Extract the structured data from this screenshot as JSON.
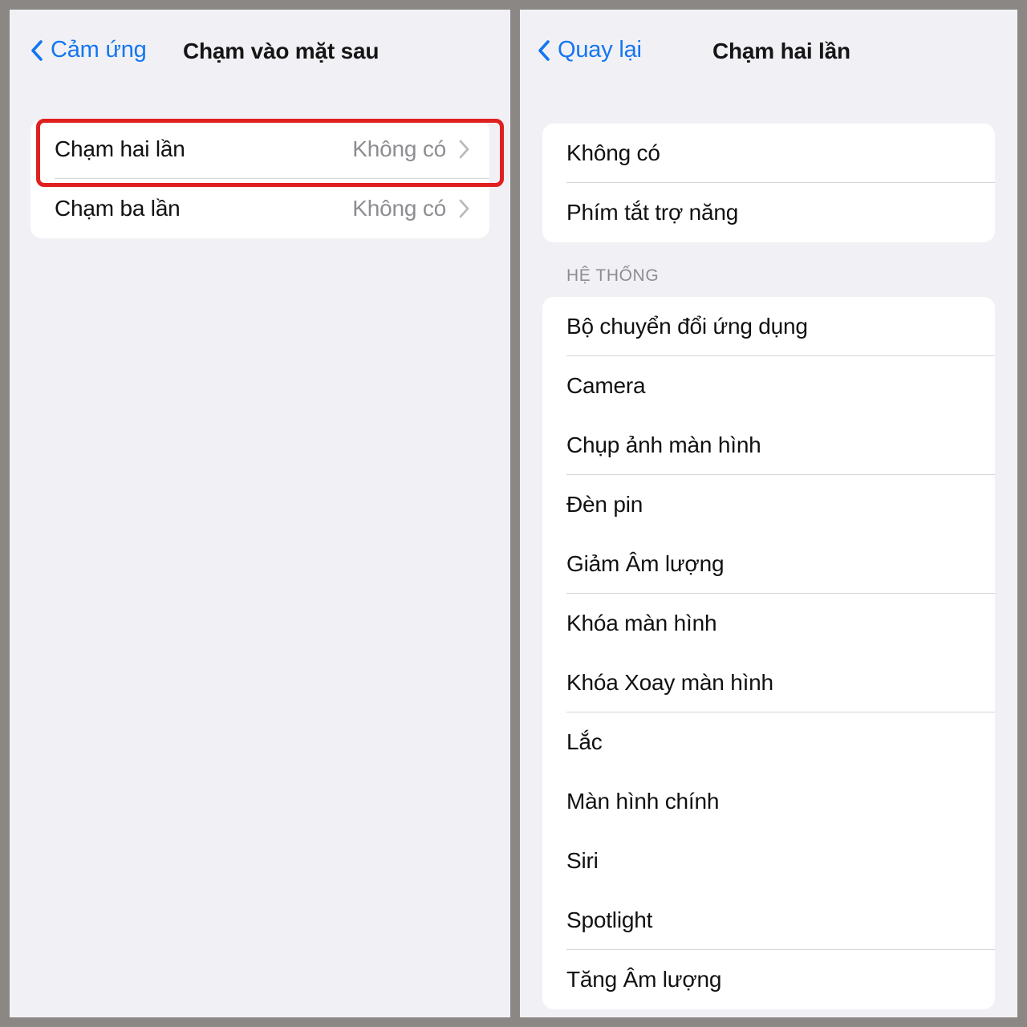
{
  "colors": {
    "frame_border": "#8b8785",
    "panel_background": "#f1f1f5",
    "card_background": "#ffffff",
    "accent_blue": "#1476f0",
    "secondary_text": "#8d8d92",
    "primary_text": "#111111",
    "separator": "#d6d6da",
    "annotation_red": "#e02020"
  },
  "left_panel": {
    "navbar": {
      "back_label": "Cảm ứng",
      "back_icon": "chevron-left-icon",
      "title": "Chạm vào mặt sau"
    },
    "rows": [
      {
        "label": "Chạm hai lần",
        "value": "Không có",
        "accessory": "chevron-right-icon",
        "highlighted": true
      },
      {
        "label": "Chạm ba lần",
        "value": "Không có",
        "accessory": "chevron-right-icon",
        "highlighted": false
      }
    ]
  },
  "right_panel": {
    "navbar": {
      "back_label": "Quay lại",
      "back_icon": "chevron-left-icon",
      "title": "Chạm hai lần"
    },
    "top_group": [
      {
        "label": "Không có"
      },
      {
        "label": "Phím tắt trợ năng"
      }
    ],
    "system_section": {
      "header": "HỆ THỐNG",
      "rows": [
        {
          "label": "Bộ chuyển đổi ứng dụng",
          "highlighted": false
        },
        {
          "label": "Camera",
          "highlighted": false
        },
        {
          "label": "Chụp ảnh màn hình",
          "highlighted": false
        },
        {
          "label": "Đèn pin",
          "highlighted": false
        },
        {
          "label": "Giảm Âm lượng",
          "highlighted": false
        },
        {
          "label": "Khóa màn hình",
          "highlighted": false
        },
        {
          "label": "Khóa Xoay màn hình",
          "highlighted": false
        },
        {
          "label": "Lắc",
          "highlighted": false
        },
        {
          "label": "Màn hình chính",
          "highlighted": true
        },
        {
          "label": "Siri",
          "highlighted": false
        },
        {
          "label": "Spotlight",
          "highlighted": false
        },
        {
          "label": "Tăng Âm lượng",
          "highlighted": false
        }
      ]
    }
  }
}
